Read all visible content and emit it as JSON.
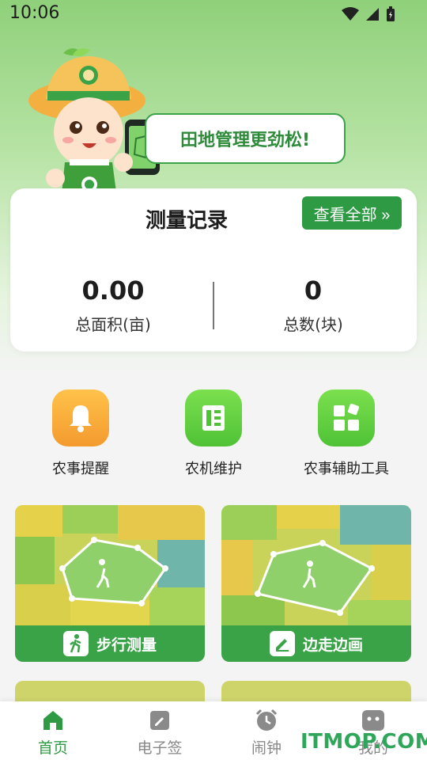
{
  "status": {
    "time": "10:06"
  },
  "hero": {
    "slogan": "田地管理更劲松!"
  },
  "records": {
    "title": "测量记录",
    "view_all": "查看全部 »",
    "area_value": "0.00",
    "area_label": "总面积(亩)",
    "count_value": "0",
    "count_label": "总数(块)"
  },
  "tools": [
    {
      "label": "农事提醒",
      "icon": "bell-icon",
      "color": "#f7a43a"
    },
    {
      "label": "农机维护",
      "icon": "toolbox-icon",
      "color": "#5fcf3a"
    },
    {
      "label": "农事辅助工具",
      "icon": "grid-tools-icon",
      "color": "#5fcf3a"
    }
  ],
  "features": [
    {
      "label": "步行测量",
      "icon": "walking-person-icon"
    },
    {
      "label": "边走边画",
      "icon": "pencil-icon"
    }
  ],
  "nav": [
    {
      "label": "首页",
      "icon": "home-icon",
      "active": true
    },
    {
      "label": "电子签",
      "icon": "sign-icon",
      "active": false
    },
    {
      "label": "闹钟",
      "icon": "alarm-clock-icon",
      "active": false
    },
    {
      "label": "我的",
      "icon": "profile-icon",
      "active": false
    }
  ],
  "watermark": "ITMOP.COM",
  "colors": {
    "accent": "#2e9b44",
    "orange": "#f7a43a",
    "lime": "#5fcf3a"
  }
}
